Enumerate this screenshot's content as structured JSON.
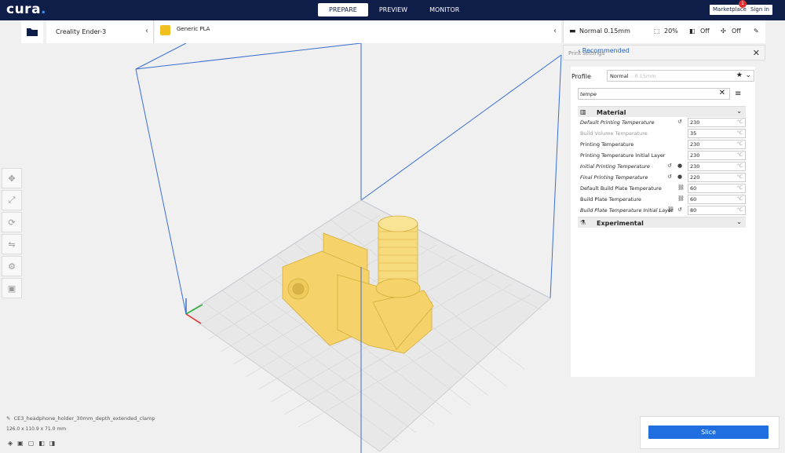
{
  "app": {
    "logo_text": "cura",
    "logo_dot": "."
  },
  "stages": [
    "PREPARE",
    "PREVIEW",
    "MONITOR"
  ],
  "header": {
    "marketplace_label": "Marketplace",
    "marketplace_badge": "1",
    "signin_label": "Sign in"
  },
  "printer": {
    "name": "Creality Ender-3"
  },
  "material": {
    "name": "Generic PLA"
  },
  "print_bar": {
    "profile": "Normal 0.15mm",
    "infill": "20%",
    "support": "Off",
    "adhesion": "Off"
  },
  "panel": {
    "title": "Print settings",
    "recommended_label": "Recommended"
  },
  "settings": {
    "profile_label": "Profile",
    "profile_value": "Normal",
    "profile_sub": "- 0.15mm",
    "search_value": "tempe",
    "categories": [
      {
        "name": "Material"
      },
      {
        "name": "Experimental"
      }
    ],
    "rows": [
      {
        "label": "Default Printing Temperature",
        "value": "230",
        "unit": "°C"
      },
      {
        "label": "Build Volume Temperature",
        "value": "35",
        "unit": "°C"
      },
      {
        "label": "Printing Temperature",
        "value": "230",
        "unit": "°C"
      },
      {
        "label": "Printing Temperature Initial Layer",
        "value": "230",
        "unit": "°C"
      },
      {
        "label": "Initial Printing Temperature",
        "value": "230",
        "unit": "°C"
      },
      {
        "label": "Final Printing Temperature",
        "value": "220",
        "unit": "°C"
      },
      {
        "label": "Default Build Plate Temperature",
        "value": "60",
        "unit": "°C"
      },
      {
        "label": "Build Plate Temperature",
        "value": "60",
        "unit": "°C"
      },
      {
        "label": "Build Plate Temperature Initial Layer",
        "value": "80",
        "unit": "°C"
      }
    ]
  },
  "object": {
    "name": "CE3_headphone_holder_30mm_depth_extended_clamp",
    "dimensions": "126.0 x 110.9 x 71.0 mm"
  },
  "slice": {
    "label": "Slice"
  },
  "colors": {
    "topbar": "#0f1d49",
    "accent": "#1f6fe0",
    "model": "#f5d36a"
  }
}
